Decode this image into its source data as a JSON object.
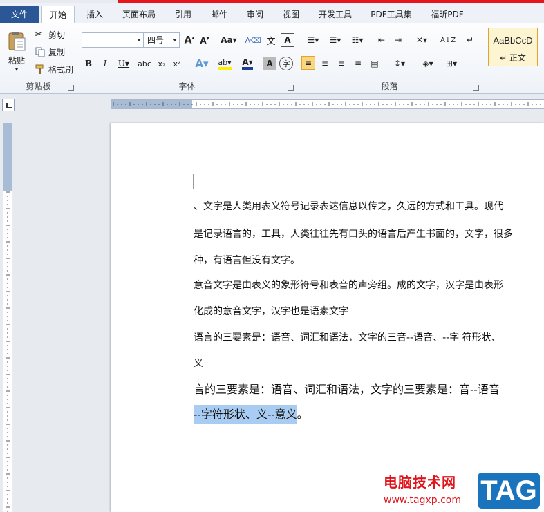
{
  "tabs": [
    {
      "label": "文件"
    },
    {
      "label": "开始"
    },
    {
      "label": "插入"
    },
    {
      "label": "页面布局"
    },
    {
      "label": "引用"
    },
    {
      "label": "邮件"
    },
    {
      "label": "审阅"
    },
    {
      "label": "视图"
    },
    {
      "label": "开发工具"
    },
    {
      "label": "PDF工具集"
    },
    {
      "label": "福昕PDF"
    }
  ],
  "clipboard": {
    "paste": "粘贴",
    "cut": "剪切",
    "copy": "复制",
    "format_painter": "格式刷",
    "label": "剪贴板"
  },
  "font": {
    "font_name": "",
    "font_size": "四号",
    "label": "字体"
  },
  "paragraph": {
    "label": "段落"
  },
  "styles": {
    "sample": "AaBbCcD",
    "name": "↵ 正文"
  },
  "document": {
    "lines": [
      "、文字是人类用表义符号记录表达信息以传之，久远的方式和工具。现代",
      "是记录语言的，工具，人类往往先有口头的语言后产生书面的，文字，很多",
      "种，有语言但没有文字。",
      "意音文字是由表义的象形符号和表音的声旁组。成的文字，汉字是由表形",
      "化成的意音文字，汉字也是语素文字",
      "语言的三要素是：语音、词汇和语法，文字的三音--语音、--字  符形状、",
      "义",
      "言的三要素是：语音、词汇和语法，文字的三要素是：音--语音"
    ],
    "selected_line": "--字符形状、义--意义",
    "after_selection": "。"
  },
  "watermark": {
    "text": "电脑技术网",
    "url": "www.tagxp.com",
    "badge": "TAG"
  },
  "colors": {
    "accent_red": "#e8141b",
    "file_tab": "#2b5797",
    "selection": "#a9cdf2",
    "style_highlight": "#fbd680"
  }
}
